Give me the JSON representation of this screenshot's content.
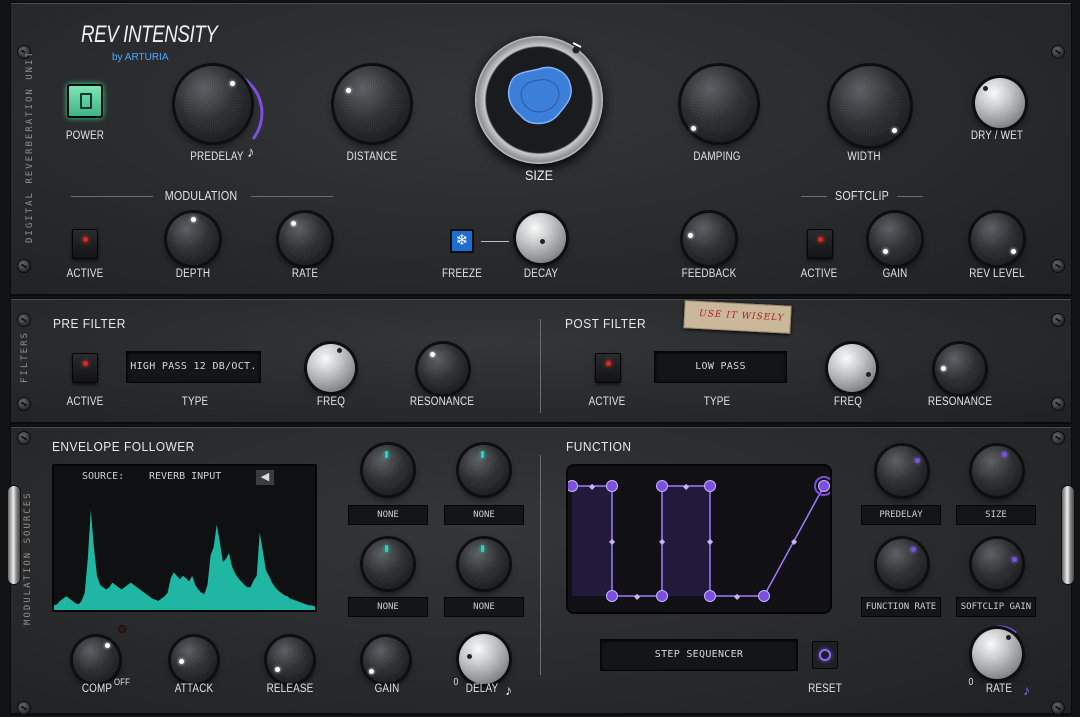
{
  "brand": {
    "title": "REV INTENSITY",
    "subtitle": "by ARTURIA"
  },
  "side_labels": {
    "top": "DIGITAL REVERBERATION UNIT",
    "filters": "FILTERS",
    "mods": "MODULATION SOURCES"
  },
  "top": {
    "power": "POWER",
    "predelay": "PREDELAY",
    "distance": "DISTANCE",
    "size": "SIZE",
    "damping": "DAMPING",
    "width": "WIDTH",
    "drywet": "DRY / WET",
    "modulation": "MODULATION",
    "mod_active": "ACTIVE",
    "depth": "DEPTH",
    "rate": "RATE",
    "freeze": "FREEZE",
    "decay": "DECAY",
    "feedback": "FEEDBACK",
    "softclip": "SOFTCLIP",
    "sc_active": "ACTIVE",
    "gain": "GAIN",
    "rev_level": "REV LEVEL"
  },
  "pre_filter": {
    "title": "PRE FILTER",
    "active": "ACTIVE",
    "type_value": "HIGH PASS 12 DB/OCT.",
    "type": "TYPE",
    "freq": "FREQ",
    "resonance": "RESONANCE"
  },
  "post_filter": {
    "title": "POST FILTER",
    "active": "ACTIVE",
    "type_value": "LOW PASS",
    "type": "TYPE",
    "freq": "FREQ",
    "resonance": "RESONANCE"
  },
  "note": "USE IT WISELY",
  "envelope": {
    "title": "ENVELOPE FOLLOWER",
    "source_label": "SOURCE:",
    "source_value": "REVERB INPUT",
    "targets": [
      "NONE",
      "NONE",
      "NONE",
      "NONE"
    ],
    "comp": "COMP",
    "off": "OFF",
    "attack": "ATTACK",
    "release": "RELEASE",
    "gain": "GAIN",
    "delay": "DELAY",
    "zero": "0",
    "waveform": [
      0.04,
      0.05,
      0.08,
      0.1,
      0.12,
      0.1,
      0.08,
      0.06,
      0.05,
      0.08,
      0.15,
      0.45,
      0.88,
      0.55,
      0.3,
      0.22,
      0.2,
      0.18,
      0.2,
      0.24,
      0.22,
      0.2,
      0.18,
      0.2,
      0.22,
      0.24,
      0.22,
      0.2,
      0.18,
      0.16,
      0.14,
      0.12,
      0.1,
      0.09,
      0.08,
      0.1,
      0.12,
      0.15,
      0.28,
      0.33,
      0.3,
      0.27,
      0.3,
      0.28,
      0.25,
      0.3,
      0.22,
      0.18,
      0.15,
      0.14,
      0.22,
      0.48,
      0.55,
      0.75,
      0.6,
      0.42,
      0.45,
      0.5,
      0.38,
      0.32,
      0.28,
      0.25,
      0.22,
      0.2,
      0.2,
      0.26,
      0.3,
      0.68,
      0.52,
      0.35,
      0.3,
      0.24,
      0.2,
      0.17,
      0.15,
      0.13,
      0.12,
      0.1,
      0.09,
      0.08,
      0.07,
      0.06,
      0.05,
      0.04,
      0.04,
      0.03
    ]
  },
  "function": {
    "title": "FUNCTION",
    "targets": [
      "PREDELAY",
      "SIZE",
      "FUNCTION RATE",
      "SOFTCLIP GAIN"
    ],
    "mode": "STEP SEQUENCER",
    "reset": "RESET",
    "rate": "RATE",
    "zero": "0"
  },
  "colors": {
    "accent": "#7b4fe0",
    "teal": "#1fb7a4",
    "led": "#e0261e"
  }
}
